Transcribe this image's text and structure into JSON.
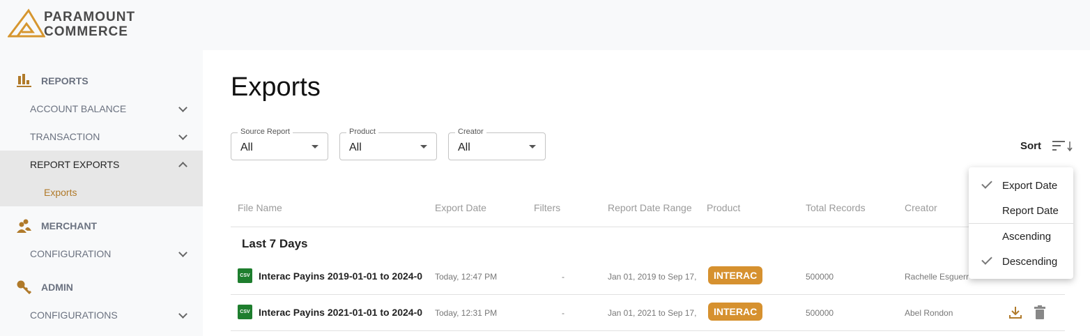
{
  "brand": {
    "line1": "PARAMOUNT",
    "line2": "COMMERCE"
  },
  "sidebar": {
    "reports": "REPORTS",
    "account_balance": "ACCOUNT BALANCE",
    "transaction": "TRANSACTION",
    "report_exports": "REPORT EXPORTS",
    "exports": "Exports",
    "merchant": "MERCHANT",
    "configuration": "CONFIGURATION",
    "admin": "ADMIN",
    "configurations": "CONFIGURATIONS"
  },
  "page": {
    "title": "Exports"
  },
  "filters": [
    {
      "label": "Source Report",
      "value": "All"
    },
    {
      "label": "Product",
      "value": "All"
    },
    {
      "label": "Creator",
      "value": "All"
    }
  ],
  "sort": {
    "label": "Sort",
    "options": [
      "Export Date",
      "Report Date",
      "Ascending",
      "Descending"
    ],
    "checked": [
      "Export Date",
      "Descending"
    ]
  },
  "table": {
    "headers": [
      "File Name",
      "Export Date",
      "Filters",
      "Report Date Range",
      "Product",
      "Total Records",
      "Creator"
    ],
    "group": "Last 7 Days",
    "rows": [
      {
        "file": "Interac Payins 2019-01-01 to 2024-0",
        "date": "Today, 12:47 PM",
        "filters": "-",
        "range": "Jan 01, 2019 to Sep 17,",
        "product": "INTERAC",
        "records": "500000",
        "creator": "Rachelle Esguerr"
      },
      {
        "file": "Interac Payins 2021-01-01 to 2024-0",
        "date": "Today, 12:31 PM",
        "filters": "-",
        "range": "Jan 01, 2021 to Sep 17,",
        "product": "INTERAC",
        "records": "500000",
        "creator": "Abel Rondon"
      }
    ],
    "file_icon": "CSV"
  },
  "colors": {
    "accent": "#d6912f",
    "icon": "#b07a2a"
  }
}
